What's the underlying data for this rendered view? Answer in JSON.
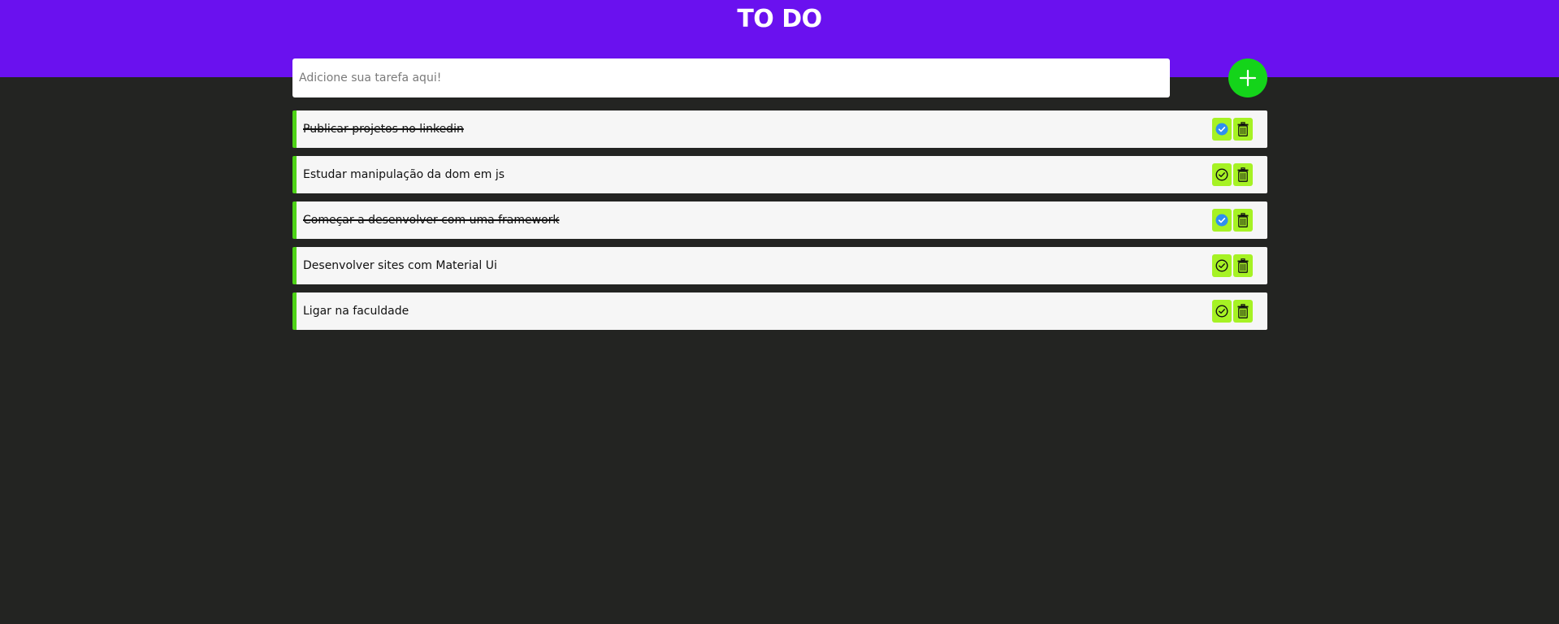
{
  "app": {
    "title": "TO DO"
  },
  "input": {
    "placeholder": "Adicione sua tarefa aqui!",
    "value": ""
  },
  "colors": {
    "header": "#6a11ef",
    "background": "#232422",
    "add_button": "#14d41a",
    "item_accent": "#4ed317",
    "action_button": "#a6f224",
    "checked_icon": "#2f8ff0"
  },
  "add_button": {
    "icon": "plus-icon"
  },
  "tasks": [
    {
      "label": "Publicar projetos no linkedin",
      "done": true
    },
    {
      "label": "Estudar manipulação da dom em js",
      "done": false
    },
    {
      "label": "Começar a desenvolver com uma framework",
      "done": true
    },
    {
      "label": "Desenvolver sites com Material Ui",
      "done": false
    },
    {
      "label": "Ligar na faculdade",
      "done": false
    }
  ],
  "task_actions": {
    "complete_icon": "check-circle-icon",
    "delete_icon": "trash-icon"
  }
}
